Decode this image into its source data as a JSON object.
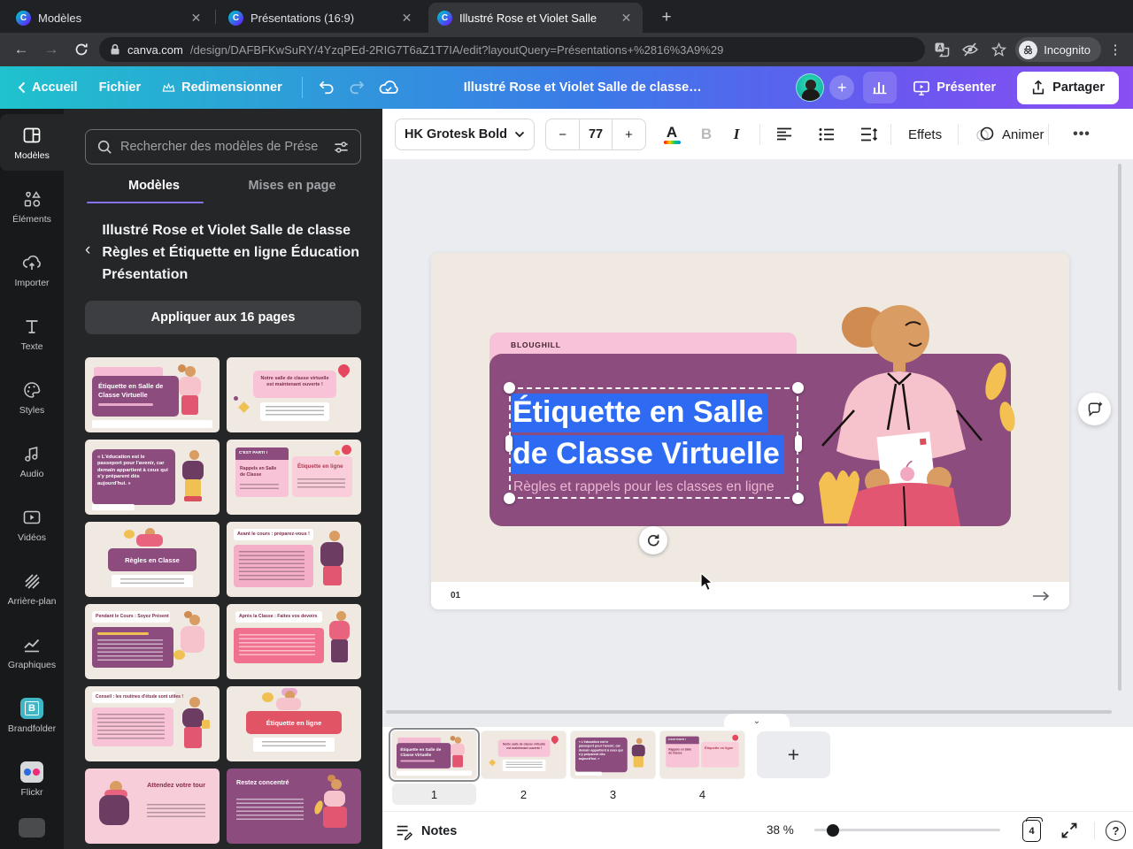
{
  "browser": {
    "tabs": [
      {
        "label": "Modèles"
      },
      {
        "label": "Présentations (16:9)"
      },
      {
        "label": "Illustré Rose et Violet Salle"
      }
    ],
    "url_domain": "canva.com",
    "url_path": "/design/DAFBFKwSuRY/4YzqPEd-2RIG7T6aZ1T7IA/edit?layoutQuery=Présentations+%2816%3A9%29",
    "incognito_label": "Incognito"
  },
  "topbar": {
    "home": "Accueil",
    "file": "Fichier",
    "resize": "Redimensionner",
    "doc_title": "Illustré Rose et Violet Salle de classe Règles ..",
    "present": "Présenter",
    "share": "Partager"
  },
  "rail": {
    "items": [
      {
        "label": "Modèles"
      },
      {
        "label": "Éléments"
      },
      {
        "label": "Importer"
      },
      {
        "label": "Texte"
      },
      {
        "label": "Styles"
      },
      {
        "label": "Audio"
      },
      {
        "label": "Vidéos"
      },
      {
        "label": "Arrière-plan"
      },
      {
        "label": "Graphiques"
      },
      {
        "label": "Brandfolder"
      },
      {
        "label": "Flickr"
      }
    ]
  },
  "panel": {
    "search_placeholder": "Rechercher des modèles de Prése",
    "tab_templates": "Modèles",
    "tab_layouts": "Mises en page",
    "collection_title": "Illustré Rose et Violet Salle de classe Règles et Étiquette en ligne Éducation Présentation",
    "apply_button": "Appliquer aux 16 pages",
    "thumbnails": [
      {
        "title": "Étiquette en Salle de Classe Virtuelle"
      },
      {
        "title": "Notre salle de classe virtuelle est maintenant ouverte !"
      },
      {
        "title": "« L'éducation est le passeport pour l'avenir, car demain appartient à ceux qui s'y préparent dès aujourd'hui. »"
      },
      {
        "header": "C'EST PARTI !",
        "left": "Rappels en Salle de Classe",
        "right": "Étiquette en ligne"
      },
      {
        "title": "Règles en Classe"
      },
      {
        "title": "Avant le cours : préparez-vous !"
      },
      {
        "title": "Pendant le Cours : Soyez Présent"
      },
      {
        "title": "Après la Classe : Faites vos devoirs"
      },
      {
        "title": "Conseil : les routines d'étude sont utiles !"
      },
      {
        "title": "Étiquette en ligne"
      },
      {
        "title": "Attendez votre tour"
      },
      {
        "title": "Restez concentré"
      }
    ]
  },
  "toolbar": {
    "font_name": "HK Grotesk Bold",
    "font_size": "77",
    "effects_label": "Effets",
    "animate_label": "Animer"
  },
  "slide": {
    "brand": "BLOUGHILL",
    "title": "Étiquette en Salle de Classe Virtuelle",
    "subtitle": "Règles et rappels pour les classes en ligne",
    "page_label": "01"
  },
  "filmstrip": {
    "page_numbers": [
      "1",
      "2",
      "3",
      "4"
    ]
  },
  "statusbar": {
    "notes_label": "Notes",
    "zoom_level": "38 %",
    "page_total": "4"
  },
  "colors": {
    "selection_blue": "#2e6bf2",
    "slide_purple": "#8c4d7e",
    "slide_pink": "#f8c3d8",
    "slide_cream": "#efe9e2",
    "panel_accent": "#8673f0"
  }
}
